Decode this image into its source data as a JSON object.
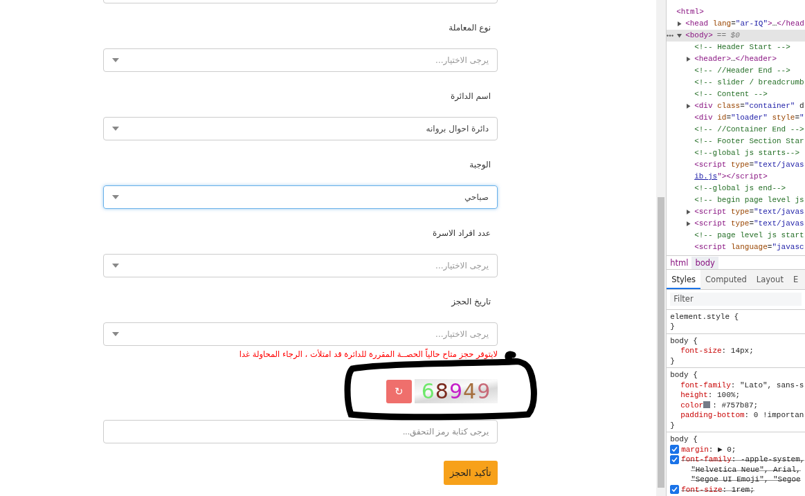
{
  "form": {
    "fields": [
      {
        "label": "نوع المعاملة",
        "placeholder": "يرجى الاختيار...",
        "focused": false
      },
      {
        "label": "اسم الدائرة",
        "value": "دائرة احوال بروانه",
        "focused": false
      },
      {
        "label": "الوجبة",
        "value": "صباحي",
        "focused": true
      },
      {
        "label": "عدد افراد الاسرة",
        "placeholder": "يرجى الاختيار...",
        "focused": false
      },
      {
        "label": "تاريخ الحجز",
        "placeholder": "يرجى الاختيار...",
        "focused": false
      }
    ],
    "error": "لايتوفر حجز متاح حالياً الحصــة المقررة للدائرة قد امتلأت ، الرجاء المحاولة غدا",
    "captcha": {
      "refresh": "↻",
      "code": "68949"
    },
    "captcha_input": {
      "placeholder": "يرجى كتابة رمز التحقق..."
    },
    "submit": "تأكيد الحجز"
  },
  "devtools": {
    "dom": [
      {
        "kind": "element",
        "text": "<html>",
        "children": [
          {
            "kind": "element",
            "text": "<head lang=\"ar-IQ\">…</head",
            "expanded": false
          },
          {
            "kind": "element",
            "text": "<body>",
            "marker": "== $0",
            "expanded": true,
            "selected": true,
            "children": [
              {
                "kind": "comment",
                "text": "<!-- Header Start -->"
              },
              {
                "kind": "element",
                "text": "<header>…</header>",
                "expanded": false
              },
              {
                "kind": "comment",
                "text": "<!-- //Header End -->"
              },
              {
                "kind": "comment",
                "text": "<!-- slider / breadcrumb"
              },
              {
                "kind": "comment",
                "text": "<!-- Content -->"
              },
              {
                "kind": "element",
                "text": "<div class=\"container\" d",
                "expanded": false
              },
              {
                "kind": "element",
                "text": "<div id=\"loader\" style=\""
              },
              {
                "kind": "comment",
                "text": "<!-- //Container End -->"
              },
              {
                "kind": "comment",
                "text": "<!-- Footer Section Star"
              },
              {
                "kind": "comment",
                "text": "<!--global js starts-->"
              },
              {
                "kind": "element",
                "text": "<script type=\"text/javas"
              },
              {
                "kind": "continuation",
                "link": "ib.js",
                "text": "\"></script>"
              },
              {
                "kind": "comment",
                "text": "<!--global js end-->"
              },
              {
                "kind": "comment",
                "text": "<!-- begin page level js"
              },
              {
                "kind": "element",
                "text": "<script type=\"text/javas",
                "expanded": false
              },
              {
                "kind": "element",
                "text": "<script type=\"text/javas",
                "expanded": false
              },
              {
                "kind": "comment",
                "text": "<!-- page level js start"
              },
              {
                "kind": "element",
                "text": "<script language=\"javasc"
              }
            ]
          }
        ]
      }
    ],
    "breadcrumbs": [
      {
        "label": "html",
        "selected": false
      },
      {
        "label": "body",
        "selected": true
      }
    ],
    "tabs": [
      {
        "label": "Styles",
        "selected": true
      },
      {
        "label": "Computed",
        "selected": false
      },
      {
        "label": "Layout",
        "selected": false
      },
      {
        "label": "E",
        "selected": false
      }
    ],
    "filter": {
      "placeholder": "Filter"
    },
    "rules": [
      {
        "selector": "element.style {",
        "close": "}"
      },
      {
        "selector": "body {",
        "close": "}",
        "properties": [
          {
            "kind": "plain",
            "name": "font-size",
            "value": ": 14px;"
          }
        ]
      },
      {
        "selector": "body {",
        "close": "}",
        "properties": [
          {
            "kind": "plain",
            "name": "font-family",
            "value": ": \"Lato\", sans-s"
          },
          {
            "kind": "plain",
            "name": "height",
            "value": ": 100%;"
          },
          {
            "kind": "color",
            "name": "color",
            "value": ": #757b87;"
          },
          {
            "kind": "plain",
            "name": "padding-bottom",
            "value": ": 0 !importan"
          }
        ]
      },
      {
        "selector": "body {",
        "properties": [
          {
            "kind": "expandable",
            "name": "margin",
            "value": ": ▶ 0;",
            "checked": true,
            "overridden": false
          },
          {
            "kind": "plain",
            "name": "font-family",
            "value": ": -apple-system,",
            "checked": true,
            "overridden": true,
            "more": [
              "\"Helvetica Neue\", Arial,",
              "\"Segoe UI Emoji\", \"Segoe"
            ]
          },
          {
            "kind": "plain",
            "name": "font-size",
            "value": ": 1rem;",
            "checked": true,
            "overridden": true
          }
        ]
      }
    ]
  }
}
